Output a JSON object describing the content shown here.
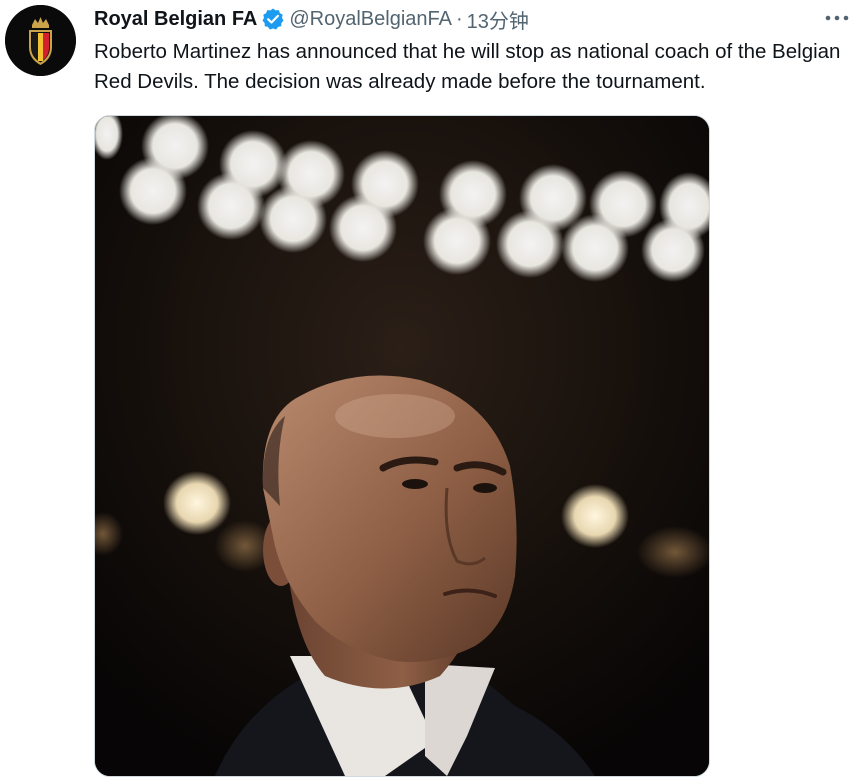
{
  "tweet": {
    "author": {
      "display_name": "Royal Belgian FA",
      "handle": "@RoyalBelgianFA",
      "verified": true,
      "avatar_icon": "royal-belgian-fa-crest"
    },
    "separator": "·",
    "time": "13分钟",
    "text": "Roberto Martinez has announced that he will stop as national coach of the Belgian Red Devils. The decision was already made before the tournament.",
    "more_icon": "more-horizontal-icon",
    "verified_color": "#1d9bf0",
    "media": {
      "description_icon": "photo-coach-under-stadium-lights"
    }
  }
}
